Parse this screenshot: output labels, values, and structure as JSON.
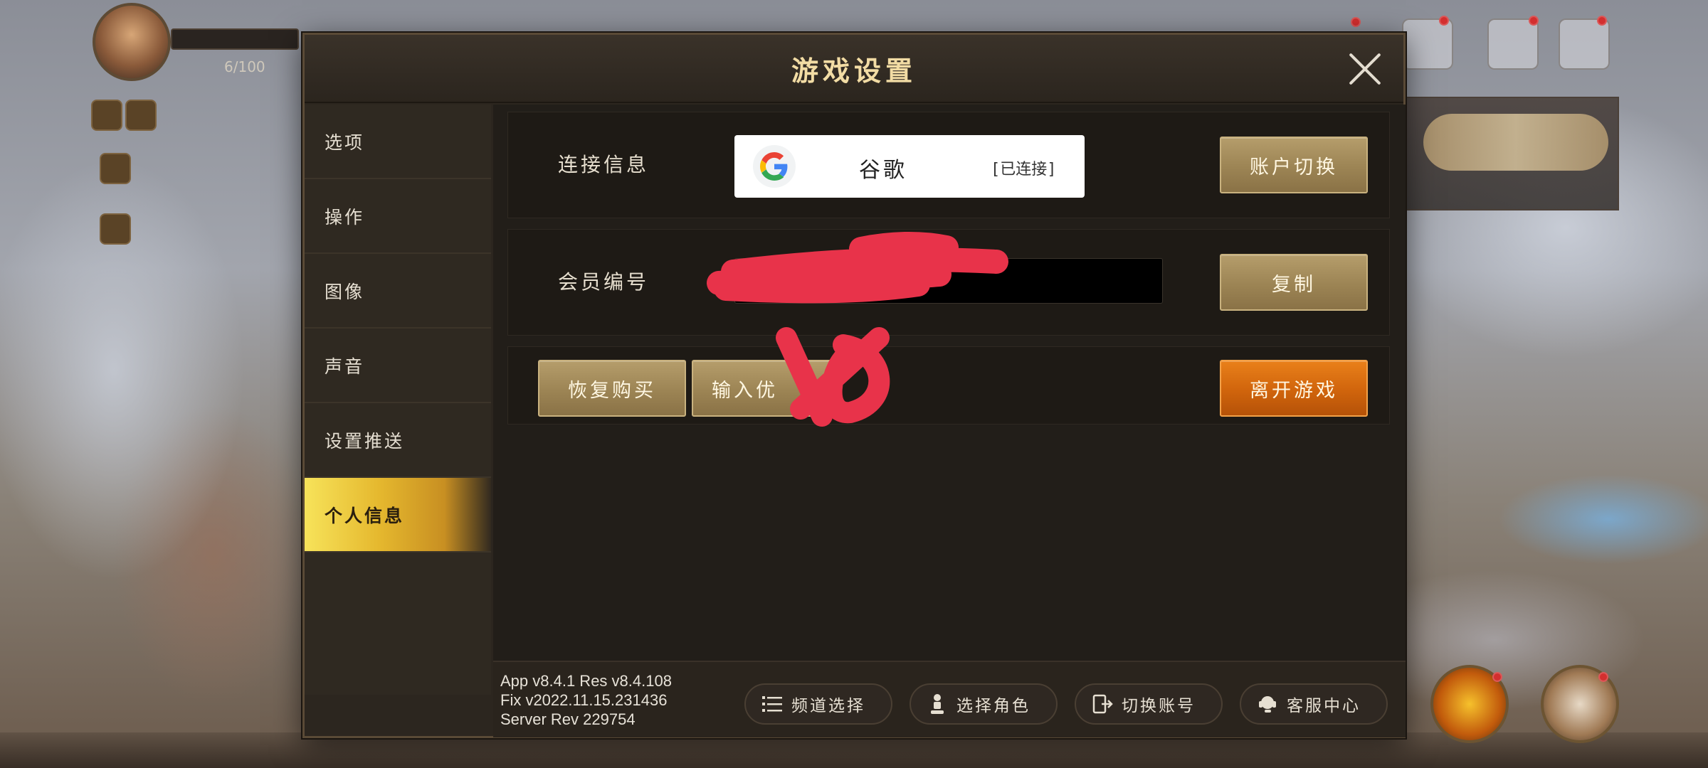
{
  "dialog": {
    "title": "游戏设置"
  },
  "sidebar": {
    "items": [
      {
        "label": "选项"
      },
      {
        "label": "操作"
      },
      {
        "label": "图像"
      },
      {
        "label": "声音"
      },
      {
        "label": "设置推送"
      },
      {
        "label": "个人信息",
        "active": true
      }
    ]
  },
  "connection": {
    "label": "连接信息",
    "provider_name": "谷歌",
    "status": "[已连接]",
    "switch_account_label": "账户切换"
  },
  "member": {
    "label": "会员编号",
    "value": "",
    "copy_label": "复制"
  },
  "actions": {
    "restore_purchase_label": "恢复购买",
    "coupon_label": "输入优",
    "leave_game_label": "离开游戏"
  },
  "footer": {
    "version_lines": [
      "App v8.4.1 Res v8.4.108",
      "Fix v2022.11.15.231436",
      "Server Rev 229754"
    ],
    "pills": [
      {
        "label": "频道选择",
        "icon": "list-icon"
      },
      {
        "label": "选择角色",
        "icon": "character-icon"
      },
      {
        "label": "切换账号",
        "icon": "switch-account-icon"
      },
      {
        "label": "客服中心",
        "icon": "support-icon"
      }
    ]
  },
  "hud": {
    "hp_text": "6/100"
  },
  "colors": {
    "accent_gold": "#f2dca4",
    "button_gold": "#9c8454",
    "button_orange": "#d0640c",
    "active_tab": "#e5b82e",
    "redaction": "#e8334a"
  }
}
